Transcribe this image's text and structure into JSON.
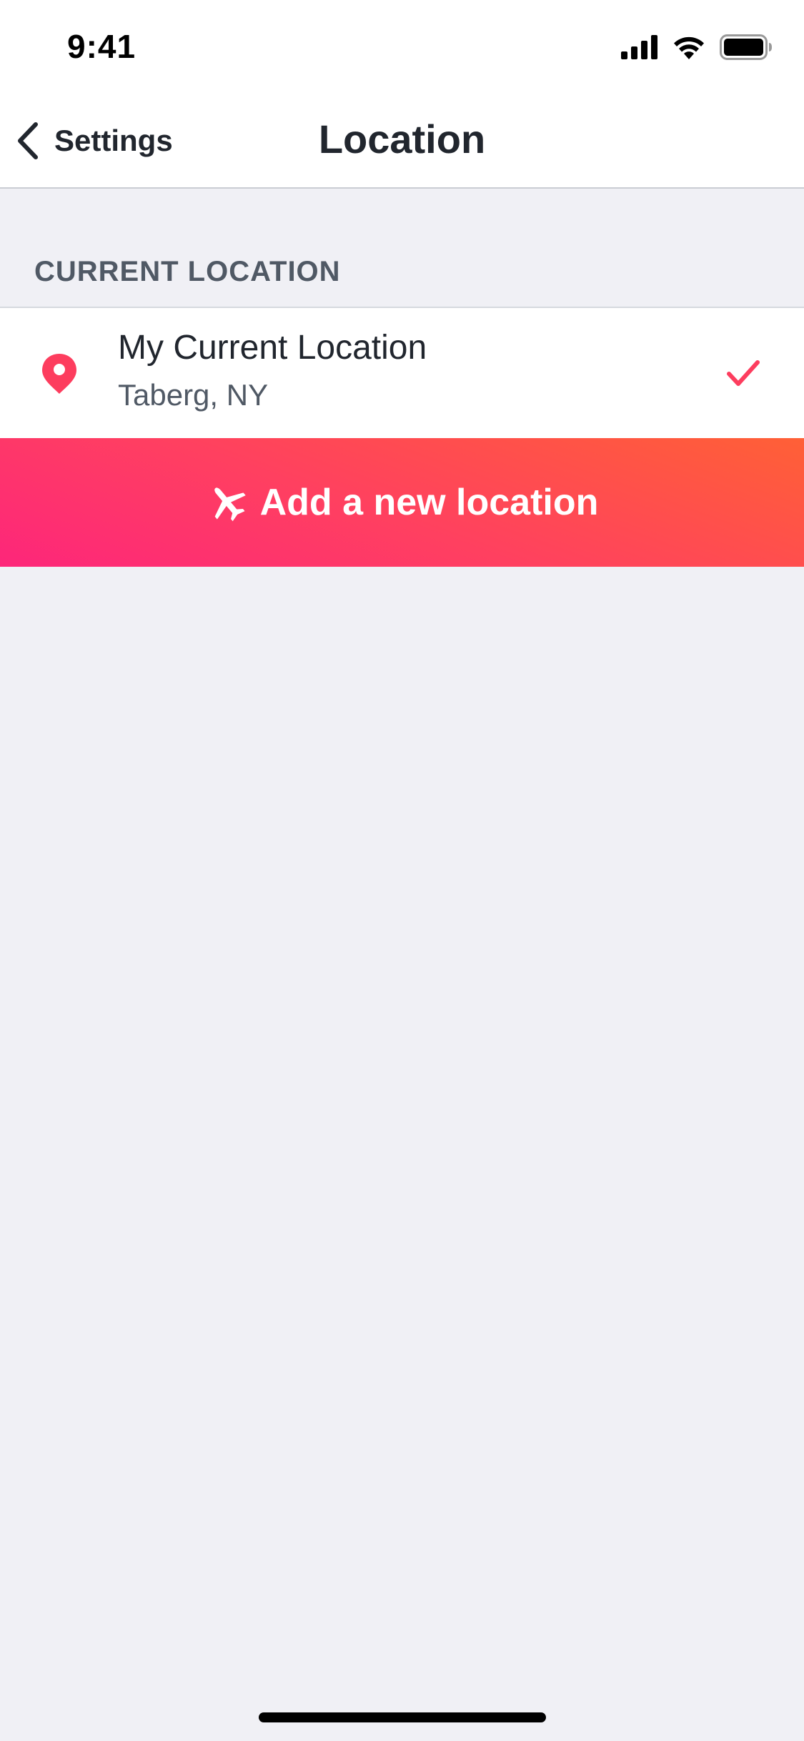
{
  "status_bar": {
    "time": "9:41",
    "icons": [
      "cellular-signal-icon",
      "wifi-icon",
      "battery-icon"
    ]
  },
  "nav": {
    "back_label": "Settings",
    "title": "Location"
  },
  "sections": {
    "current_location_header": "CURRENT LOCATION"
  },
  "current_location": {
    "title": "My Current Location",
    "subtitle": "Taberg, NY",
    "selected": true,
    "icon": "map-pin-icon"
  },
  "add_location": {
    "label": "Add a new location",
    "icon": "airplane-icon"
  },
  "colors": {
    "accent_pin": "#FD3D5E",
    "accent_check": "#FD3D5E",
    "gradient_start": "#FD267A",
    "gradient_end": "#FF6036",
    "background": "#F0F0F5"
  }
}
